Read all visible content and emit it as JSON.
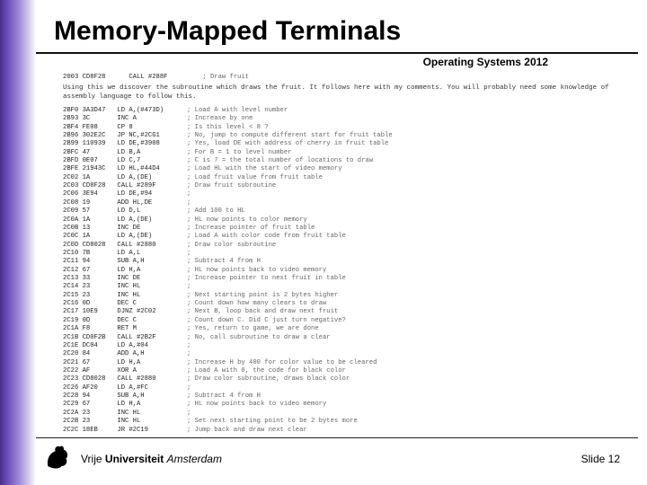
{
  "header": {
    "title": "Memory-Mapped Terminals",
    "course": "Operating Systems 2012"
  },
  "footer": {
    "uni_part1": "Vrije",
    "uni_part2": "Universiteit",
    "uni_part3": "Amsterdam",
    "slide_label": "Slide 12"
  },
  "intro_text": "Using this we discover the subroutine which draws the fruit. It follows here with my comments. You will probably need some knowledge of assembly language to follow this.",
  "top_call": {
    "addr": "2003 CD8F28",
    "asm": "CALL #288F",
    "cmt": "; Draw fruit"
  },
  "code": [
    {
      "addr": "2BF0 3A3D47",
      "asm": "LD A,(#473D)",
      "cmt": "; Load A with level number"
    },
    {
      "addr": "2B93 3C",
      "asm": "INC A",
      "cmt": "; Increase by one"
    },
    {
      "addr": "2BF4 FE08",
      "asm": "CP 8",
      "cmt": "; Is this level < 8 ?"
    },
    {
      "addr": "2B96 302E2C",
      "asm": "JP NC,#2CG1",
      "cmt": "; No, jump to compute different start for fruit table"
    },
    {
      "addr": "2B99 110939",
      "asm": "LD DE,#3908",
      "cmt": "; Yes, load DE with address of cherry in fruit table"
    },
    {
      "addr": "2BFC 47",
      "asm": "LD B,A",
      "cmt": "; For B = 1 to level number"
    },
    {
      "addr": "2BFD 0E07",
      "asm": "LD C,7",
      "cmt": "; C is 7 = the total number of locations to draw"
    },
    {
      "addr": "2BFE 21943C",
      "asm": "LD HL,#44D4",
      "cmt": "; Load HL with the start of video memory"
    },
    {
      "addr": "2C02 1A",
      "asm": "LD A,(DE)",
      "cmt": "; Load fruit value from fruit table"
    },
    {
      "addr": "2C03 CD8F28",
      "asm": "CALL #289F",
      "cmt": "; Draw fruit subroutine"
    },
    {
      "addr": "2C06 3E94",
      "asm": "LD DE,#94",
      "cmt": ";"
    },
    {
      "addr": "2C08 19",
      "asm": "ADD HL,DE",
      "cmt": ";"
    },
    {
      "addr": "2C09 57",
      "asm": "LD D,L",
      "cmt": "; Add 100 to HL"
    },
    {
      "addr": "2C0A 1A",
      "asm": "LD A,(DE)",
      "cmt": "; HL now points to color memory"
    },
    {
      "addr": "2C0B 13",
      "asm": "INC DE",
      "cmt": "; Increase pointer of fruit table"
    },
    {
      "addr": "2C0C 1A",
      "asm": "LD A,(DE)",
      "cmt": "; Load A with color code from fruit table"
    },
    {
      "addr": "2C0D CD8028",
      "asm": "CALL #2880",
      "cmt": "; Draw color subroutine"
    },
    {
      "addr": "2C10 7B",
      "asm": "LD A,L",
      "cmt": ";"
    },
    {
      "addr": "2C11 94",
      "asm": "SUB A,H",
      "cmt": "; Subtract 4 from H"
    },
    {
      "addr": "2C12 67",
      "asm": "LD H,A",
      "cmt": "; HL now points back to video memory"
    },
    {
      "addr": "2C13 33",
      "asm": "INC DE",
      "cmt": "; Increase pointer to next fruit in table"
    },
    {
      "addr": "2C14 23",
      "asm": "INC HL",
      "cmt": ";"
    },
    {
      "addr": "2C15 23",
      "asm": "INC HL",
      "cmt": "; Next starting point is 2 bytes higher"
    },
    {
      "addr": "2C16 0D",
      "asm": "DEC C",
      "cmt": "; Count down how many clears to draw"
    },
    {
      "addr": "2C17 10E9",
      "asm": "DJNZ #2C02",
      "cmt": "; Next B, loop back and draw next fruit"
    },
    {
      "addr": "2C19 0D",
      "asm": "DEC C",
      "cmt": "; Count down C. Did C just turn negative?"
    },
    {
      "addr": "2C1A F8",
      "asm": "RET M",
      "cmt": "; Yes, return to game, we are done"
    },
    {
      "addr": "2C1B CD0F2B",
      "asm": "CALL #2B2F",
      "cmt": "; No, call subroutine to draw a clear"
    },
    {
      "addr": "2C1E DC04",
      "asm": "LD A,#04",
      "cmt": ";"
    },
    {
      "addr": "2C20 84",
      "asm": "ADD A,H",
      "cmt": ";"
    },
    {
      "addr": "2C21 67",
      "asm": "LD H,A",
      "cmt": "; Increase H by 400 for color value to be cleared"
    },
    {
      "addr": "2C22 AF",
      "asm": "XOR A",
      "cmt": "; Load A with 0, the code for black color"
    },
    {
      "addr": "2C23 CD8028",
      "asm": "CALL #2880",
      "cmt": "; Draw color subroutine, draws black color"
    },
    {
      "addr": "2C26 AF20",
      "asm": "LD A,#FC",
      "cmt": ";"
    },
    {
      "addr": "2C28 94",
      "asm": "SUB A,H",
      "cmt": "; Subtract 4 from H"
    },
    {
      "addr": "2C29 67",
      "asm": "LD H,A",
      "cmt": "; HL now points back to video memory"
    },
    {
      "addr": "2C2A 23",
      "asm": "INC HL",
      "cmt": ";"
    },
    {
      "addr": "2C2B 23",
      "asm": "INC HL",
      "cmt": "; Set next starting point to be 2 bytes more"
    },
    {
      "addr": "2C2C 18EB",
      "asm": "JR #2C19",
      "cmt": "; Jump back and draw next clear"
    }
  ]
}
